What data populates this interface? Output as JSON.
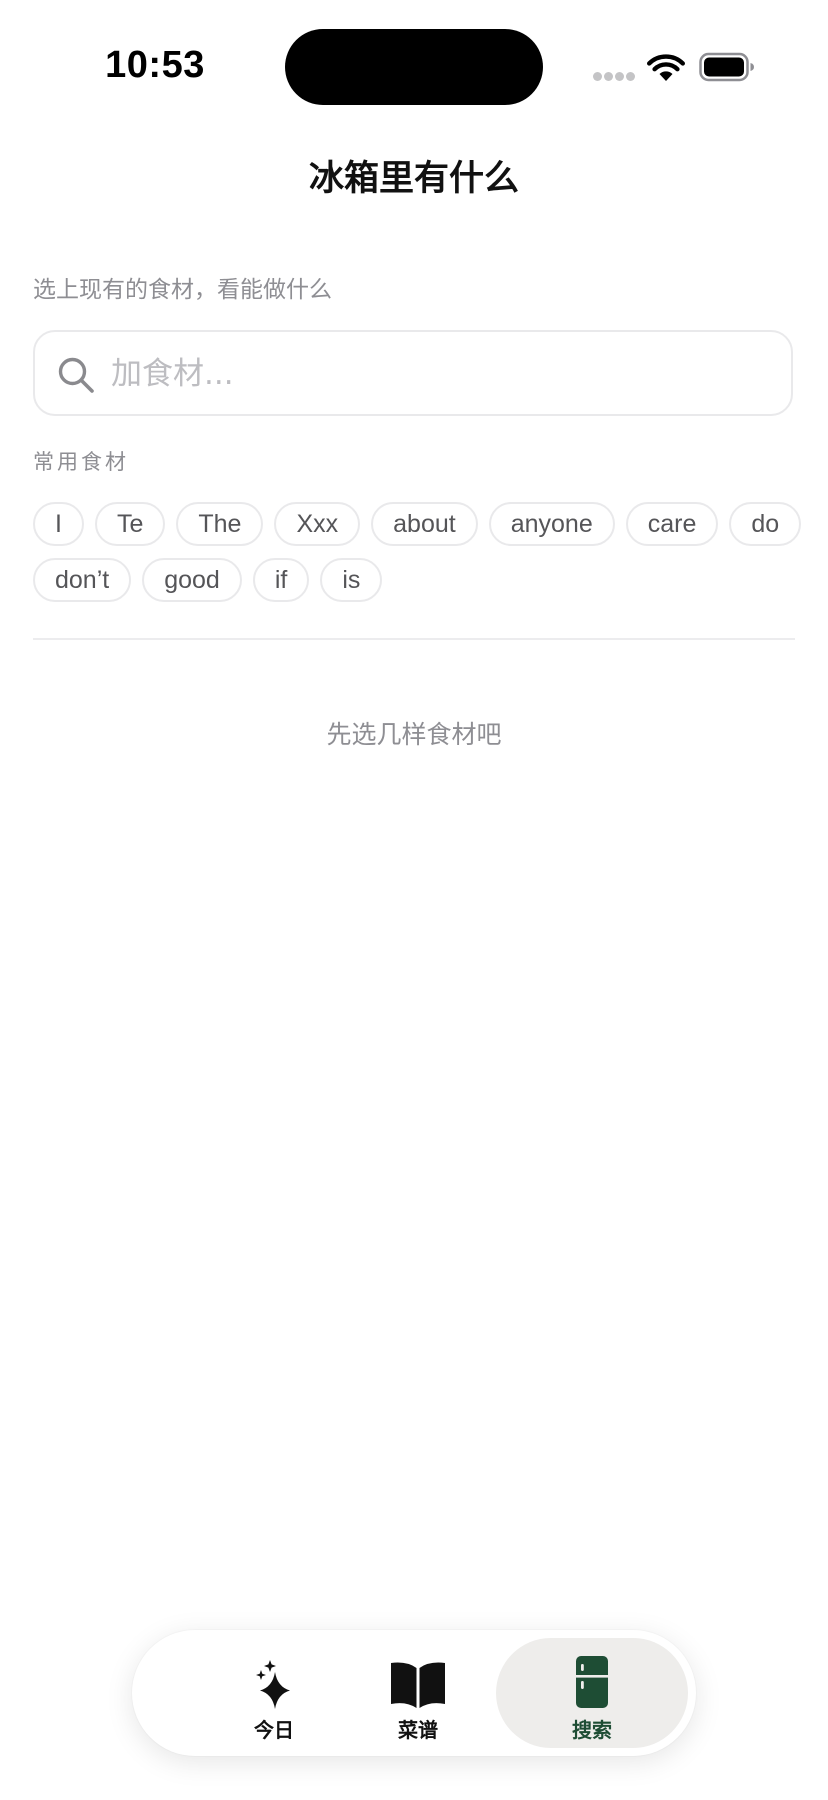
{
  "status_bar": {
    "time": "10:53"
  },
  "header": {
    "title": "冰箱里有什么"
  },
  "main": {
    "subtitle": "选上现有的食材，看能做什么",
    "search": {
      "placeholder": "加食材..."
    },
    "common_label": "常用食材",
    "ingredients": [
      "I",
      "Te",
      "The",
      "Xxx",
      "about",
      "anyone",
      "care",
      "do",
      "don’t",
      "good",
      "if",
      "is"
    ],
    "empty_hint": "先选几样食材吧"
  },
  "tab_bar": {
    "tabs": [
      {
        "label": "今日",
        "icon": "sparkles-icon",
        "active": false
      },
      {
        "label": "菜谱",
        "icon": "book-icon",
        "active": false
      },
      {
        "label": "搜索",
        "icon": "fridge-icon",
        "active": true
      }
    ]
  },
  "colors": {
    "accent": "#1e4d34",
    "active_tab_bg": "#eeedeb",
    "muted_text": "#8e8e93",
    "chip_border": "#e9e9eb"
  }
}
